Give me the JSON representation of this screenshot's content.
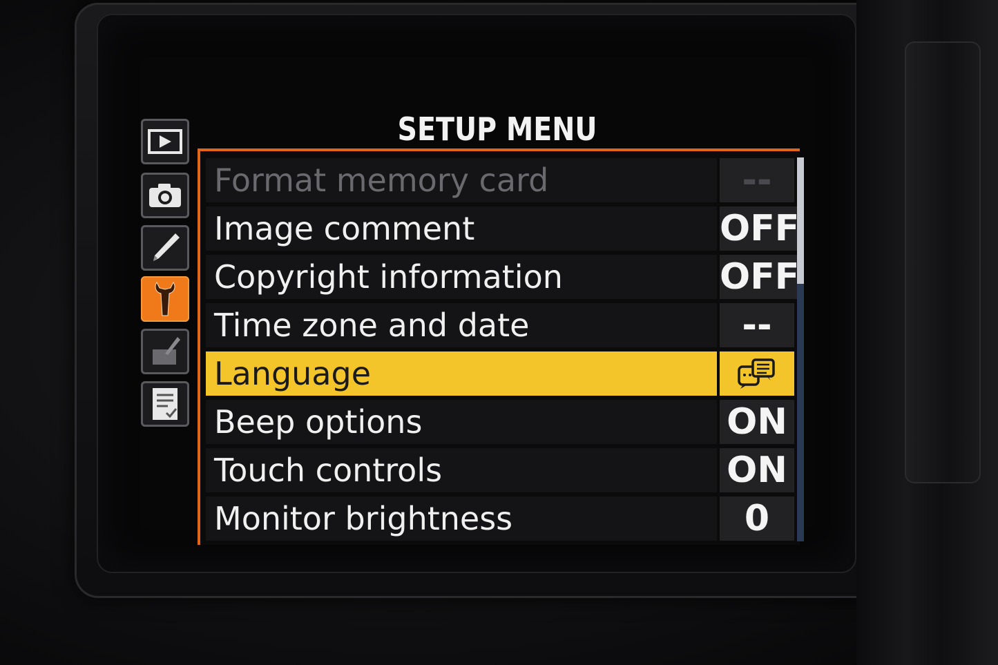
{
  "screen": {
    "title": "SETUP MENU"
  },
  "tabs": [
    {
      "name": "playback-menu-tab",
      "icon": "playback-icon",
      "active": false
    },
    {
      "name": "photo-shooting-menu-tab",
      "icon": "camera-icon",
      "active": false
    },
    {
      "name": "custom-settings-menu-tab",
      "icon": "pencil-icon",
      "active": false
    },
    {
      "name": "setup-menu-tab",
      "icon": "wrench-icon",
      "active": true
    },
    {
      "name": "retouch-menu-tab",
      "icon": "retouch-brush-icon",
      "active": false
    },
    {
      "name": "my-menu-tab",
      "icon": "my-menu-list-icon",
      "active": false
    }
  ],
  "menu": {
    "items": [
      {
        "label": "Format memory card",
        "value": "--",
        "state": "disabled"
      },
      {
        "label": "Image comment",
        "value": "OFF",
        "state": "normal"
      },
      {
        "label": "Copyright information",
        "value": "OFF",
        "state": "normal"
      },
      {
        "label": "Time zone and date",
        "value": "--",
        "state": "normal"
      },
      {
        "label": "Language",
        "value": "",
        "value_icon": "language-icon",
        "state": "selected"
      },
      {
        "label": "Beep options",
        "value": "ON",
        "state": "normal"
      },
      {
        "label": "Touch controls",
        "value": "ON",
        "state": "normal"
      },
      {
        "label": "Monitor brightness",
        "value": "0",
        "state": "normal"
      }
    ]
  },
  "scroll": {
    "position": 0,
    "visible_fraction": 0.33
  },
  "colors": {
    "accent_orange": "#e0661a",
    "active_tab": "#f07a1a",
    "selected_row": "#f3c52a",
    "row_background": "#141416",
    "value_background": "#222225",
    "scroll_track": "#2a3a55"
  }
}
